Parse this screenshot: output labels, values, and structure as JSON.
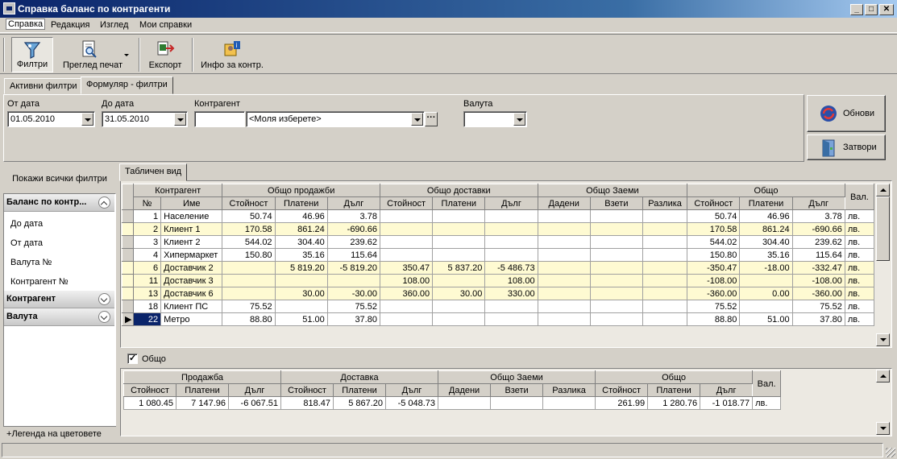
{
  "window": {
    "title": "Справка баланс по контрагенти"
  },
  "menu": [
    "Справка",
    "Редакция",
    "Изглед",
    "Мои справки"
  ],
  "toolbar": {
    "filters": "Филтри",
    "print_preview": "Преглед печат",
    "export": "Експорт",
    "info": "Инфо за контр."
  },
  "tabs": {
    "active_filters": "Активни филтри",
    "form_filters": "Формуляр - филтри"
  },
  "filters": {
    "from_date_label": "От дата",
    "from_date": "01.05.2010",
    "to_date_label": "До дата",
    "to_date": "31.05.2010",
    "contractor_label": "Контрагент",
    "contractor_code": "",
    "contractor_value": "<Моля изберете>",
    "currency_label": "Валута",
    "currency_value": ""
  },
  "actions": {
    "refresh": "Обнови",
    "close": "Затвори"
  },
  "sidebar": {
    "show_all": "Покажи всички филтри",
    "group1": "Баланс по контр...",
    "items": [
      "До дата",
      "От дата",
      "Валута №",
      "Контрагент №"
    ],
    "group2": "Контрагент",
    "group3": "Валута",
    "legend": "Легенда на цветовете"
  },
  "view_tab": "Табличен вид",
  "grid": {
    "groups": [
      "Контрагент",
      "Общо продажби",
      "Общо доставки",
      "Общо Заеми",
      "Общо",
      "Вал."
    ],
    "cols": [
      "№",
      "Име",
      "Стойност",
      "Платени",
      "Дълг",
      "Стойност",
      "Платени",
      "Дълг",
      "Дадени",
      "Взети",
      "Разлика",
      "Стойност",
      "Платени",
      "Дълг"
    ],
    "rows": [
      {
        "no": "1",
        "name": "Население",
        "c": [
          "50.74",
          "46.96",
          "3.78",
          "",
          "",
          "",
          "",
          "",
          "",
          "50.74",
          "46.96",
          "3.78"
        ],
        "cur": "лв.",
        "y": false
      },
      {
        "no": "2",
        "name": "Клиент 1",
        "c": [
          "170.58",
          "861.24",
          "-690.66",
          "",
          "",
          "",
          "",
          "",
          "",
          "170.58",
          "861.24",
          "-690.66"
        ],
        "cur": "лв.",
        "y": true
      },
      {
        "no": "3",
        "name": "Клиент 2",
        "c": [
          "544.02",
          "304.40",
          "239.62",
          "",
          "",
          "",
          "",
          "",
          "",
          "544.02",
          "304.40",
          "239.62"
        ],
        "cur": "лв.",
        "y": false
      },
      {
        "no": "4",
        "name": "Хипермаркет",
        "c": [
          "150.80",
          "35.16",
          "115.64",
          "",
          "",
          "",
          "",
          "",
          "",
          "150.80",
          "35.16",
          "115.64"
        ],
        "cur": "лв.",
        "y": false
      },
      {
        "no": "6",
        "name": "Доставчик 2",
        "c": [
          "",
          "5 819.20",
          "-5 819.20",
          "350.47",
          "5 837.20",
          "-5 486.73",
          "",
          "",
          "",
          "-350.47",
          "-18.00",
          "-332.47"
        ],
        "cur": "лв.",
        "y": true
      },
      {
        "no": "11",
        "name": "Доставчик 3",
        "c": [
          "",
          "",
          "",
          "108.00",
          "",
          "108.00",
          "",
          "",
          "",
          "-108.00",
          "",
          "-108.00"
        ],
        "cur": "лв.",
        "y": true
      },
      {
        "no": "13",
        "name": "Доставчик 6",
        "c": [
          "",
          "30.00",
          "-30.00",
          "360.00",
          "30.00",
          "330.00",
          "",
          "",
          "",
          "-360.00",
          "0.00",
          "-360.00"
        ],
        "cur": "лв.",
        "y": true
      },
      {
        "no": "18",
        "name": "Клиент ПС",
        "c": [
          "75.52",
          "",
          "75.52",
          "",
          "",
          "",
          "",
          "",
          "",
          "75.52",
          "",
          "75.52"
        ],
        "cur": "лв.",
        "y": false
      },
      {
        "no": "22",
        "name": "Метро",
        "c": [
          "88.80",
          "51.00",
          "37.80",
          "",
          "",
          "",
          "",
          "",
          "",
          "88.80",
          "51.00",
          "37.80"
        ],
        "cur": "лв.",
        "y": false
      }
    ]
  },
  "totals": {
    "checkbox_label": "Общо",
    "groups": [
      "Продажба",
      "Доставка",
      "Общо Заеми",
      "Общо",
      "Вал."
    ],
    "cols": [
      "Стойност",
      "Платени",
      "Дълг",
      "Стойност",
      "Платени",
      "Дълг",
      "Дадени",
      "Взети",
      "Разлика",
      "Стойност",
      "Платени",
      "Дълг"
    ],
    "row": [
      "1 080.45",
      "7 147.96",
      "-6 067.51",
      "818.47",
      "5 867.20",
      "-5 048.73",
      "",
      "",
      "",
      "261.99",
      "1 280.76",
      "-1 018.77"
    ],
    "cur": "лв."
  }
}
